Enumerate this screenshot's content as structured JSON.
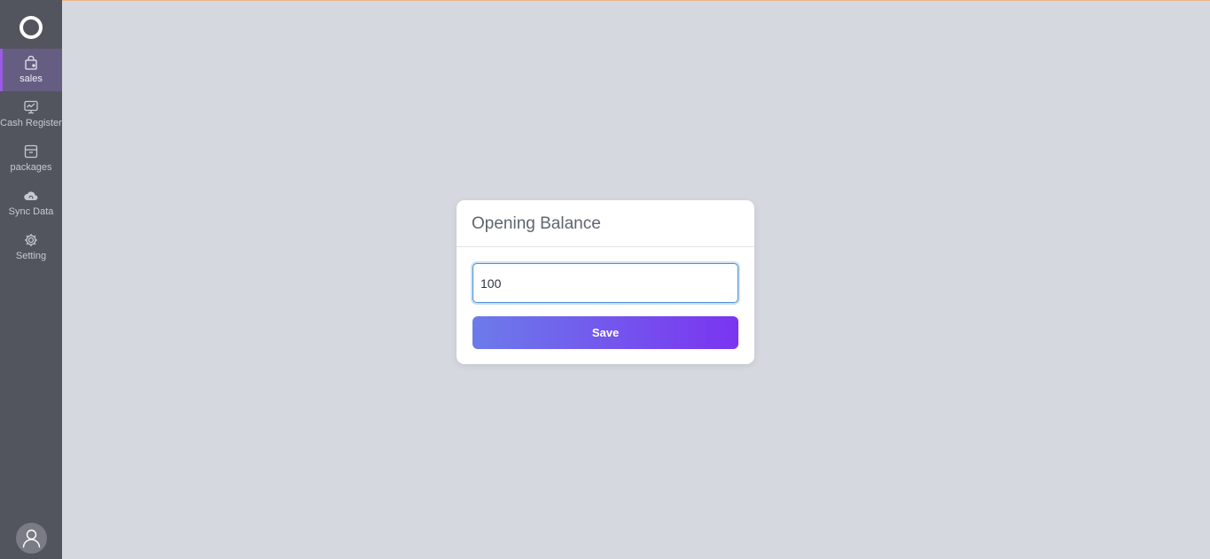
{
  "sidebar": {
    "logo_icon": "ring-logo-icon",
    "items": [
      {
        "label": "sales",
        "icon": "shopping-bag-icon",
        "active": true
      },
      {
        "label": "Cash Register",
        "icon": "monitor-chart-icon",
        "active": false
      },
      {
        "label": "packages",
        "icon": "archive-box-icon",
        "active": false
      },
      {
        "label": "Sync Data",
        "icon": "cloud-sync-icon",
        "active": false
      },
      {
        "label": "Setting",
        "icon": "gear-icon",
        "active": false
      }
    ],
    "avatar_icon": "user-avatar-icon"
  },
  "modal": {
    "title": "Opening Balance",
    "input_value": "100",
    "save_label": "Save"
  },
  "colors": {
    "background": "#d6d8e0",
    "sidebar": "#53555e",
    "active_item": "#655e82",
    "active_accent": "#9b5be8",
    "button_gradient_start": "#6c7bea",
    "button_gradient_end": "#7a34f0",
    "input_focus": "#4d8fd8"
  }
}
